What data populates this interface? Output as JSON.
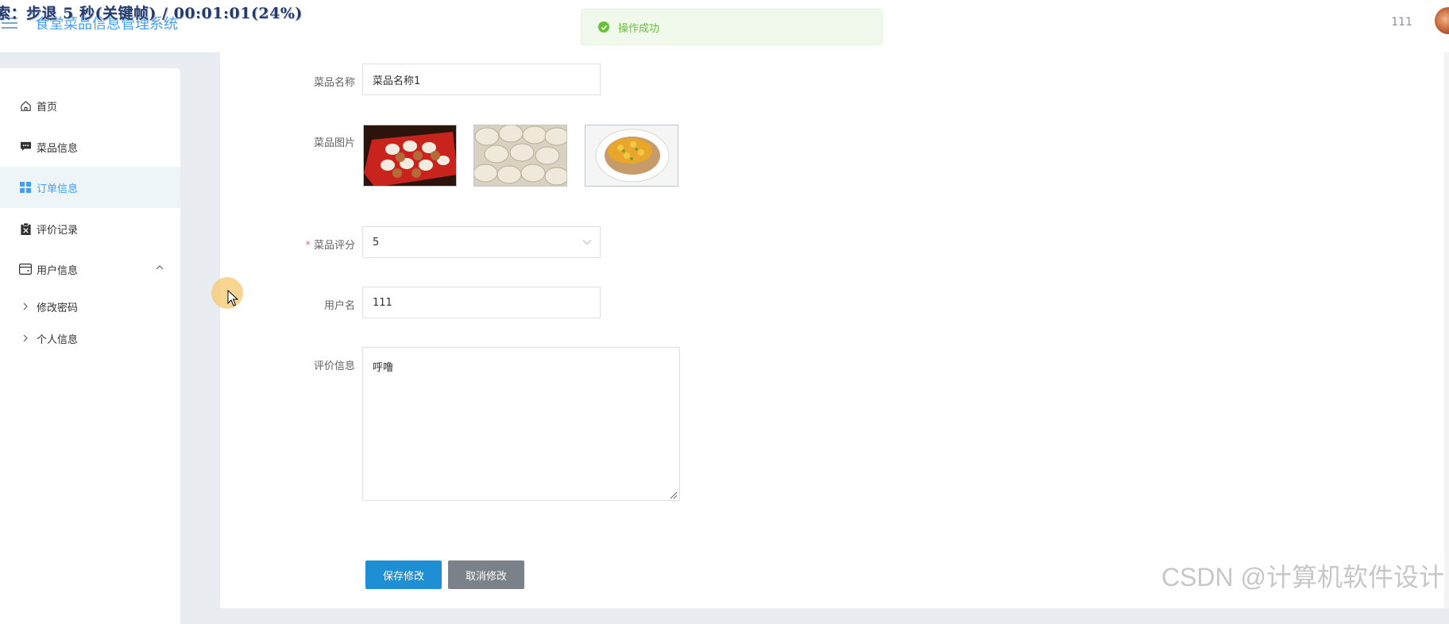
{
  "overlay_text": "索：步退 5 秒(关键帧) / 00:01:01(24%)",
  "header": {
    "title": "食堂菜品信息管理系统",
    "username": "111"
  },
  "toast": {
    "message": "操作成功"
  },
  "sidebar": {
    "items": [
      {
        "label": "首页",
        "icon": "home-icon"
      },
      {
        "label": "菜品信息",
        "icon": "chat-icon"
      },
      {
        "label": "订单信息",
        "icon": "grid-icon"
      },
      {
        "label": "评价记录",
        "icon": "clipboard-icon"
      },
      {
        "label": "用户信息",
        "icon": "wallet-icon"
      }
    ],
    "sub_items": [
      {
        "label": "修改密码"
      },
      {
        "label": "个人信息"
      }
    ]
  },
  "form": {
    "dish_name": {
      "label": "菜品名称",
      "value": "菜品名称1"
    },
    "dish_image": {
      "label": "菜品图片"
    },
    "rating": {
      "label": "菜品评分",
      "value": "5"
    },
    "username": {
      "label": "用户名",
      "value": "111"
    },
    "review": {
      "label": "评价信息",
      "value": "呼噜"
    },
    "save_label": "保存修改",
    "cancel_label": "取消修改"
  },
  "watermark": "CSDN @计算机软件设计",
  "colors": {
    "primary": "#409eff",
    "success": "#67c23a",
    "save_button": "#1f8fd3",
    "cancel_button": "#7a8189",
    "required": "#f56c6c"
  }
}
